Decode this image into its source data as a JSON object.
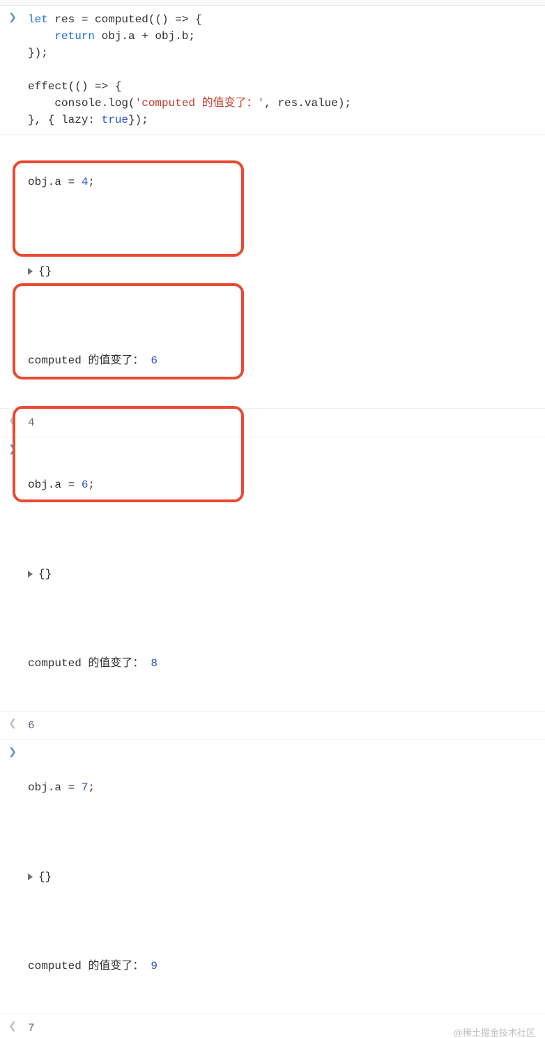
{
  "code": {
    "line1_let": "let",
    "line1_rest": " res = computed(() => {",
    "line2_return": "return",
    "line2_rest": " obj.a + obj.b;",
    "line3": "});",
    "line5": "effect(() => {",
    "line6_pre": "    console.log(",
    "line6_str": "'computed 的值变了：'",
    "line6_post": ", res.value);",
    "line7_pre": "}, { lazy: ",
    "line7_true": "true",
    "line7_post": "});"
  },
  "groups": [
    {
      "input_pre": "obj.a = ",
      "input_num": "4",
      "input_post": ";",
      "obj": "{}",
      "log_text": "computed 的值变了：",
      "log_val": "6",
      "output": "4"
    },
    {
      "input_pre": "obj.a = ",
      "input_num": "6",
      "input_post": ";",
      "obj": "{}",
      "log_text": "computed 的值变了：",
      "log_val": "8",
      "output": "6"
    },
    {
      "input_pre": "obj.a = ",
      "input_num": "7",
      "input_post": ";",
      "obj": "{}",
      "log_text": "computed 的值变了：",
      "log_val": "9",
      "output": "7"
    }
  ],
  "watermark": "@稀土掘金技术社区"
}
